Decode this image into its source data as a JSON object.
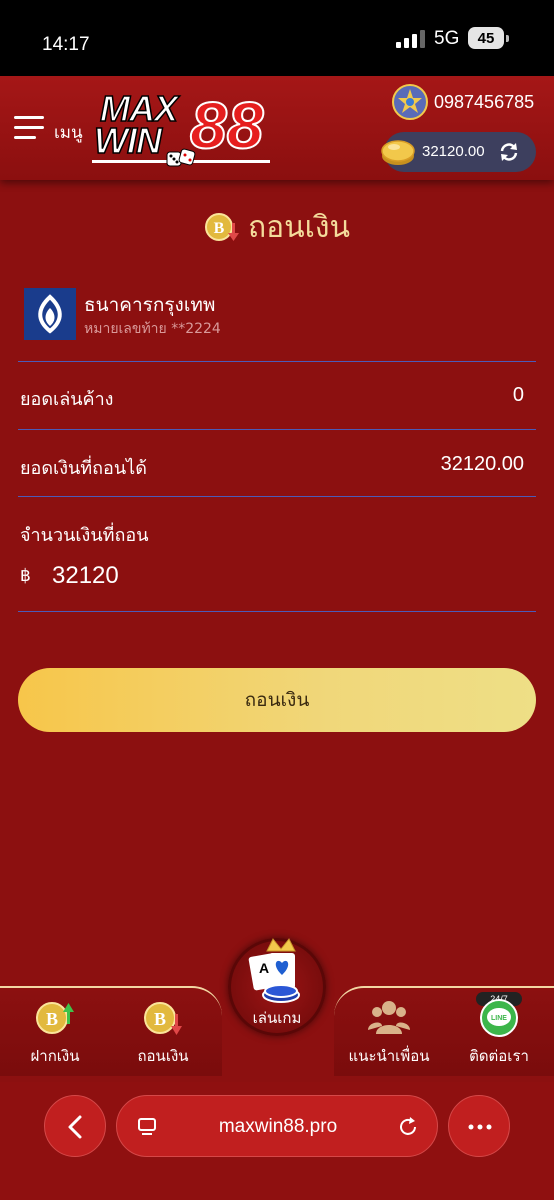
{
  "status_bar": {
    "time": "14:17",
    "network": "5G",
    "battery": "45"
  },
  "header": {
    "menu_label": "เมนู",
    "logo": {
      "line1": "MAX",
      "line2": "WIN",
      "number": "88"
    },
    "phone": "0987456785",
    "balance": "32120.00"
  },
  "page": {
    "title": "ถอนเงิน"
  },
  "bank": {
    "name": "ธนาคารกรุงเทพ",
    "account_hint": "หมายเลขท้าย **2224"
  },
  "rows": {
    "turnover_label": "ยอดเล่นค้าง",
    "turnover_value": "0",
    "withdrawable_label": "ยอดเงินที่ถอนได้",
    "withdrawable_value": "32120.00",
    "amount_label": "จำนวนเงินที่ถอน",
    "currency_symbol": "฿",
    "amount_value": "32120"
  },
  "withdraw_button_label": "ถอนเงิน",
  "bottom_nav": {
    "deposit": "ฝากเงิน",
    "withdraw": "ถอนเงิน",
    "play": "เล่นเกม",
    "refer": "แนะนำเพื่อน",
    "contact": "ติดต่อเรา",
    "badge": "24/7"
  },
  "browser": {
    "url": "maxwin88.pro"
  },
  "colors": {
    "background": "#8c1010",
    "title_gold": "#f4dc9c",
    "button_gold": "#f3cf5c",
    "divider_blue": "#4b5bb8",
    "bank_blue": "#1a3c8c"
  }
}
